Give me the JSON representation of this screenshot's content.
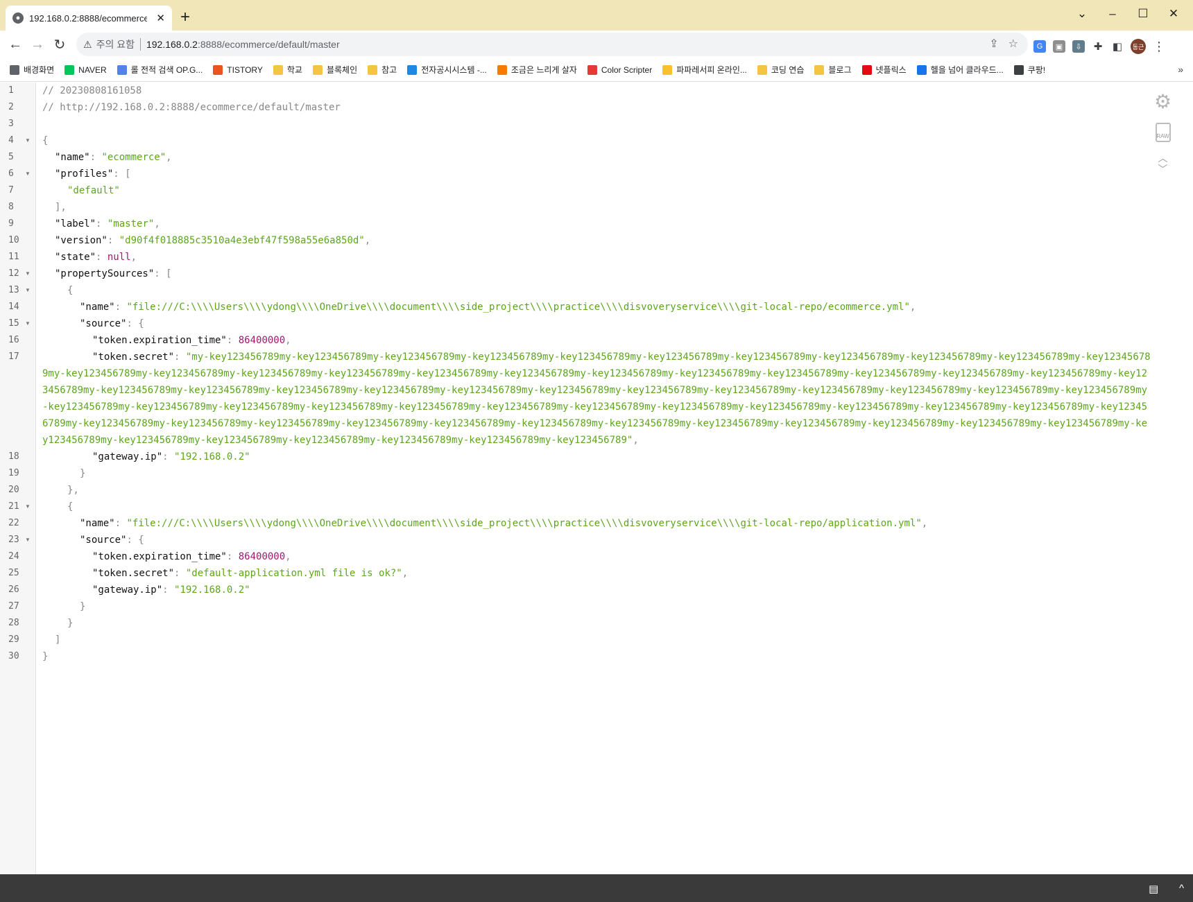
{
  "browser": {
    "tab_title": "192.168.0.2:8888/ecommerce/de",
    "tab_close": "✕",
    "new_tab": "+",
    "security_label": "주의 요함",
    "url": "192.168.0.2:8888/ecommerce/default/master",
    "url_display_host": "192.168.0.2",
    "url_display_rest": ":8888/ecommerce/default/master",
    "avatar_label": "동근"
  },
  "bookmarks": [
    {
      "label": "배경화면",
      "icon": "image-icon",
      "color": "#5f6368"
    },
    {
      "label": "NAVER",
      "icon": "naver-icon",
      "color": "#03c75a"
    },
    {
      "label": "롤 전적 검색 OP.G...",
      "icon": "opgg-icon",
      "color": "#5383e8"
    },
    {
      "label": "TISTORY",
      "icon": "tistory-icon",
      "color": "#eb531f"
    },
    {
      "label": "학교",
      "icon": "folder-icon",
      "color": "#f4c542"
    },
    {
      "label": "블록체인",
      "icon": "folder-icon",
      "color": "#f4c542"
    },
    {
      "label": "참고",
      "icon": "folder-icon",
      "color": "#f4c542"
    },
    {
      "label": "전자공시시스템 -...",
      "icon": "dart-icon",
      "color": "#1e88e5"
    },
    {
      "label": "조금은 느리게 살자",
      "icon": "blogger-icon",
      "color": "#f57c00"
    },
    {
      "label": "Color Scripter",
      "icon": "colorscripter-icon",
      "color": "#e53935"
    },
    {
      "label": "파파레서피 온라인...",
      "icon": "papa-icon",
      "color": "#fbc02d"
    },
    {
      "label": "코딩 연습",
      "icon": "folder-icon",
      "color": "#f4c542"
    },
    {
      "label": "블로그",
      "icon": "folder-icon",
      "color": "#f4c542"
    },
    {
      "label": "넷플릭스",
      "icon": "netflix-icon",
      "color": "#e50914"
    },
    {
      "label": "헬을 넘어 클라우드...",
      "icon": "g-icon",
      "color": "#1a73e8"
    },
    {
      "label": "쿠팡!",
      "icon": "globe-icon",
      "color": "#3c4043"
    }
  ],
  "json_viewer": {
    "line_numbers": [
      "1",
      "2",
      "3",
      "4",
      "5",
      "6",
      "7",
      "8",
      "9",
      "10",
      "11",
      "12",
      "13",
      "14",
      "15",
      "16",
      "17",
      "18",
      "19",
      "20",
      "21",
      "22",
      "23",
      "24",
      "25",
      "26",
      "27",
      "28",
      "29",
      "30"
    ],
    "comment_timestamp": "// 20230808161058",
    "comment_url": "// http://192.168.0.2:8888/ecommerce/default/master",
    "name_key": "\"name\"",
    "name_value": "\"ecommerce\"",
    "profiles_key": "\"profiles\"",
    "profiles_value": "\"default\"",
    "label_key": "\"label\"",
    "label_value": "\"master\"",
    "version_key": "\"version\"",
    "version_value": "\"d90f4f018885c3510a4e3ebf47f598a55e6a850d\"",
    "state_key": "\"state\"",
    "state_value": "null",
    "property_sources_key": "\"propertySources\"",
    "ps1_name_value": "\"file:///C:\\\\\\\\Users\\\\\\\\ydong\\\\\\\\OneDrive\\\\\\\\document\\\\\\\\side_project\\\\\\\\practice\\\\\\\\disvoveryservice\\\\\\\\git-local-repo/ecommerce.yml\"",
    "source_key": "\"source\"",
    "token_exp_key": "\"token.expiration_time\"",
    "token_exp_value": "86400000",
    "token_secret_key": "\"token.secret\"",
    "ps1_secret_value": "\"my-key123456789my-key123456789my-key123456789my-key123456789my-key123456789my-key123456789my-key123456789my-key123456789my-key123456789my-key123456789my-key123456789my-key123456789my-key123456789my-key123456789my-key123456789my-key123456789my-key123456789my-key123456789my-key123456789my-key123456789my-key123456789my-key123456789my-key123456789my-key123456789my-key123456789my-key123456789my-key123456789my-key123456789my-key123456789my-key123456789my-key123456789my-key123456789my-key123456789my-key123456789my-key123456789my-key123456789my-key123456789my-key123456789my-key123456789my-key123456789my-key123456789my-key123456789my-key123456789my-key123456789my-key123456789my-key123456789my-key123456789my-key123456789my-key123456789my-key123456789my-key123456789my-key123456789my-key123456789my-key123456789my-key123456789my-key123456789my-key123456789my-key123456789my-key123456789my-key123456789my-key123456789my-key123456789my-key123456789my-key123456789my-key123456789my-key123456789my-key123456789my-key123456789\"",
    "gateway_key": "\"gateway.ip\"",
    "gateway_value": "\"192.168.0.2\"",
    "ps2_name_value": "\"file:///C:\\\\\\\\Users\\\\\\\\ydong\\\\\\\\OneDrive\\\\\\\\document\\\\\\\\side_project\\\\\\\\practice\\\\\\\\disvoveryservice\\\\\\\\git-local-repo/application.yml\"",
    "ps2_secret_value": "\"default-application.yml file is ok?\""
  },
  "viewer_tools": {
    "raw_label": "RAW"
  }
}
